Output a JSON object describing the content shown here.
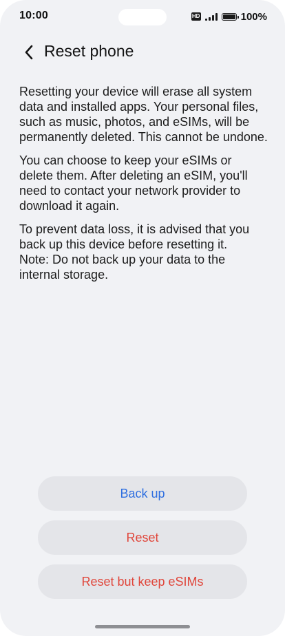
{
  "status": {
    "time": "10:00",
    "hd_label": "HD",
    "battery": "100%"
  },
  "header": {
    "title": "Reset phone",
    "back_icon": "chevron-left-icon"
  },
  "body": {
    "paragraph1": "Resetting your device will erase all system data and installed apps. Your personal files, such as music, photos, and eSIMs, will be permanently deleted. This cannot be undone.",
    "paragraph2": "You can choose to keep your eSIMs or delete them. After deleting an eSIM, you'll need to contact your network provider to download it again.",
    "paragraph3": "To prevent data loss, it is advised that you back up this device before resetting it.",
    "paragraph4": "Note: Do not back up your data to the internal storage."
  },
  "actions": {
    "backup_label": "Back up",
    "reset_label": "Reset",
    "reset_keep_label": "Reset but keep eSIMs"
  },
  "colors": {
    "background": "#f1f2f5",
    "button_bg": "#e4e5e9",
    "blue": "#2f6fe0",
    "red": "#e0463b"
  }
}
